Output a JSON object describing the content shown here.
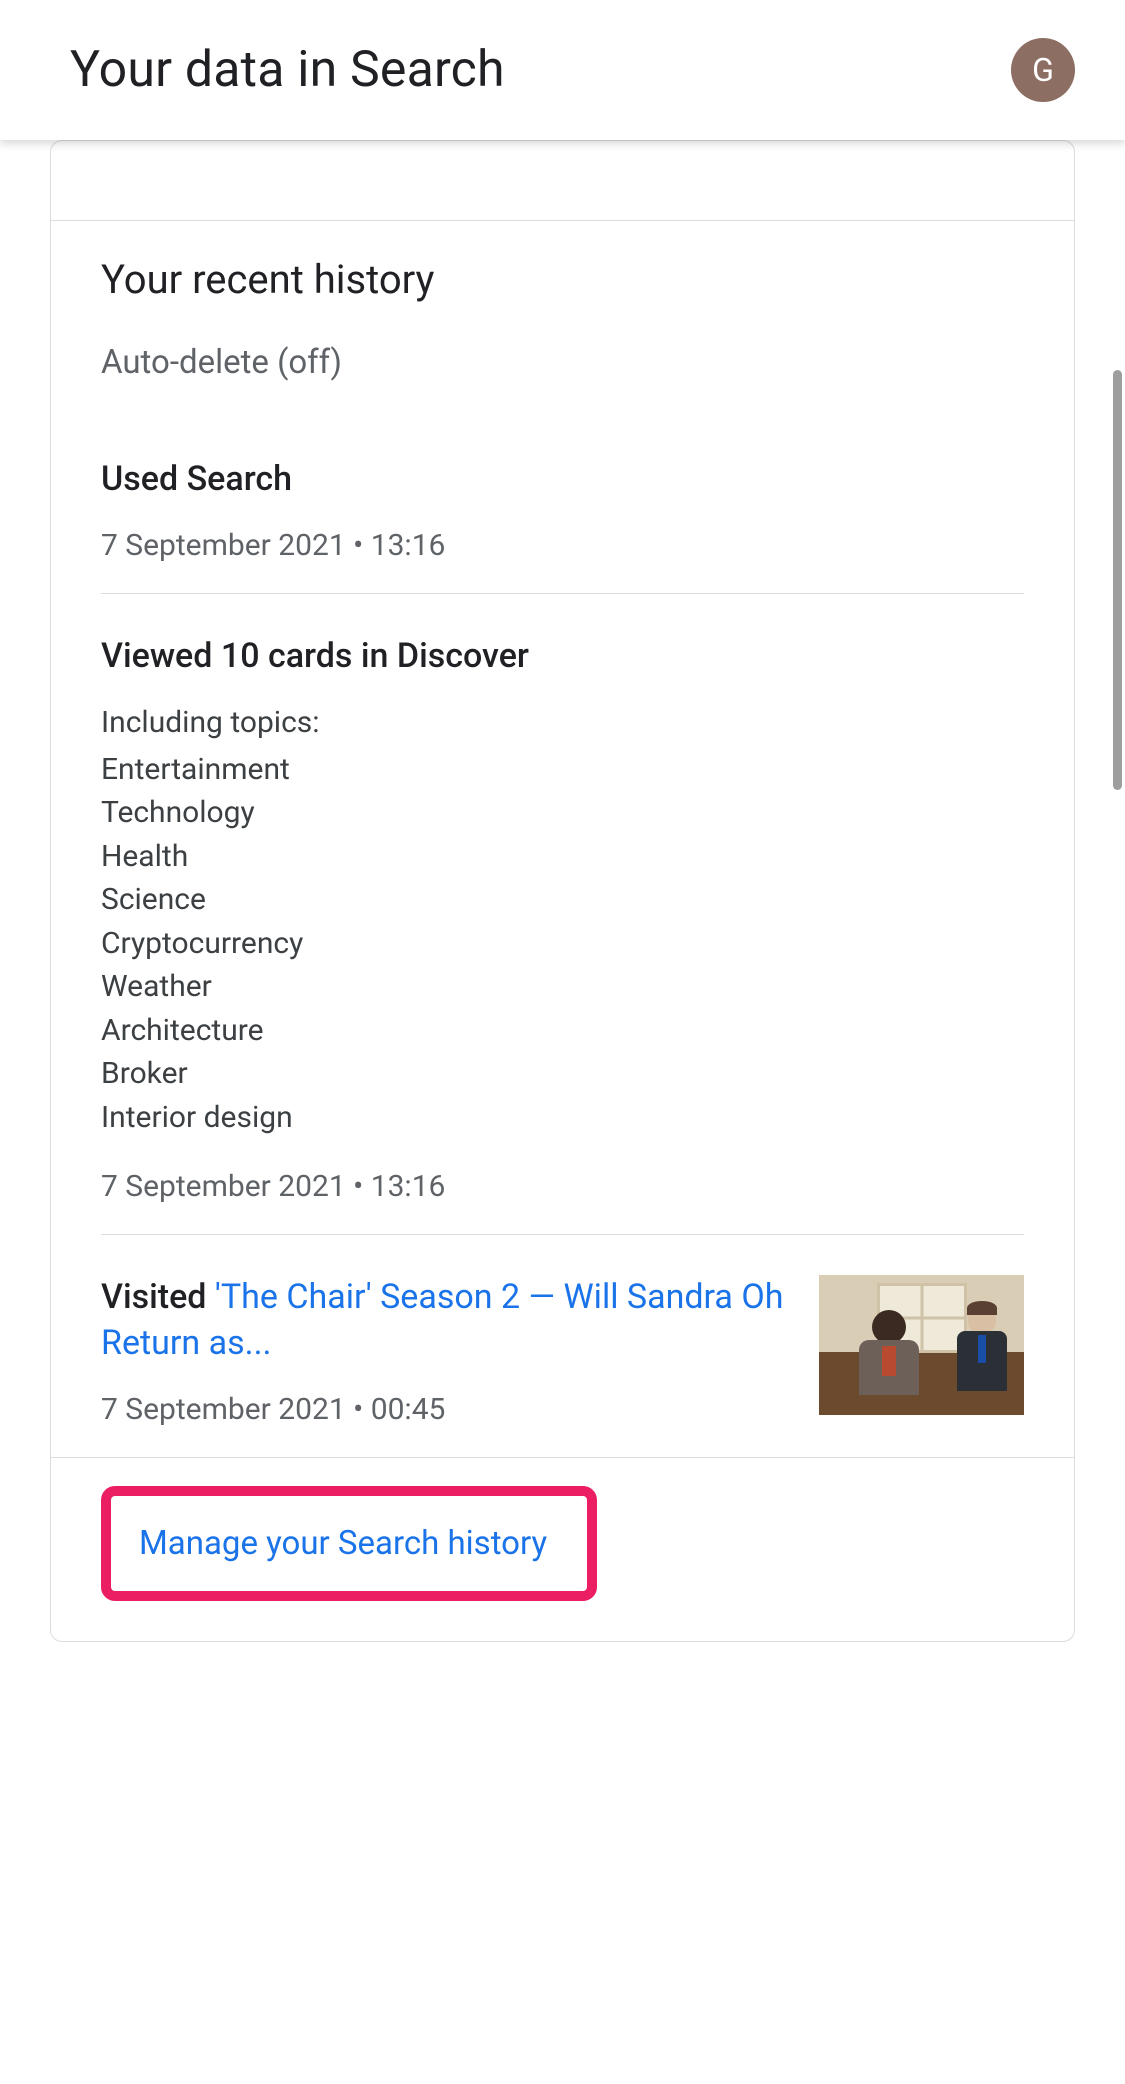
{
  "header": {
    "title": "Your data in Search",
    "avatar_initial": "G"
  },
  "history": {
    "section_title": "Your recent history",
    "auto_delete_status": "Auto-delete (off)",
    "items": [
      {
        "title": "Used Search",
        "timestamp": "7 September 2021 • 13:16"
      },
      {
        "title": "Viewed 10 cards in Discover",
        "topics_intro": "Including topics:",
        "topics": [
          "Entertainment",
          "Technology",
          "Health",
          "Science",
          "Cryptocurrency",
          "Weather",
          "Architecture",
          "Broker",
          "Interior design"
        ],
        "timestamp": "7 September 2021 • 13:16"
      },
      {
        "prefix": "Visited ",
        "link_text": "'The Chair' Season 2 — Will Sandra Oh Return as...",
        "timestamp": "7 September 2021 • 00:45"
      }
    ]
  },
  "footer": {
    "manage_link": "Manage your Search history"
  }
}
